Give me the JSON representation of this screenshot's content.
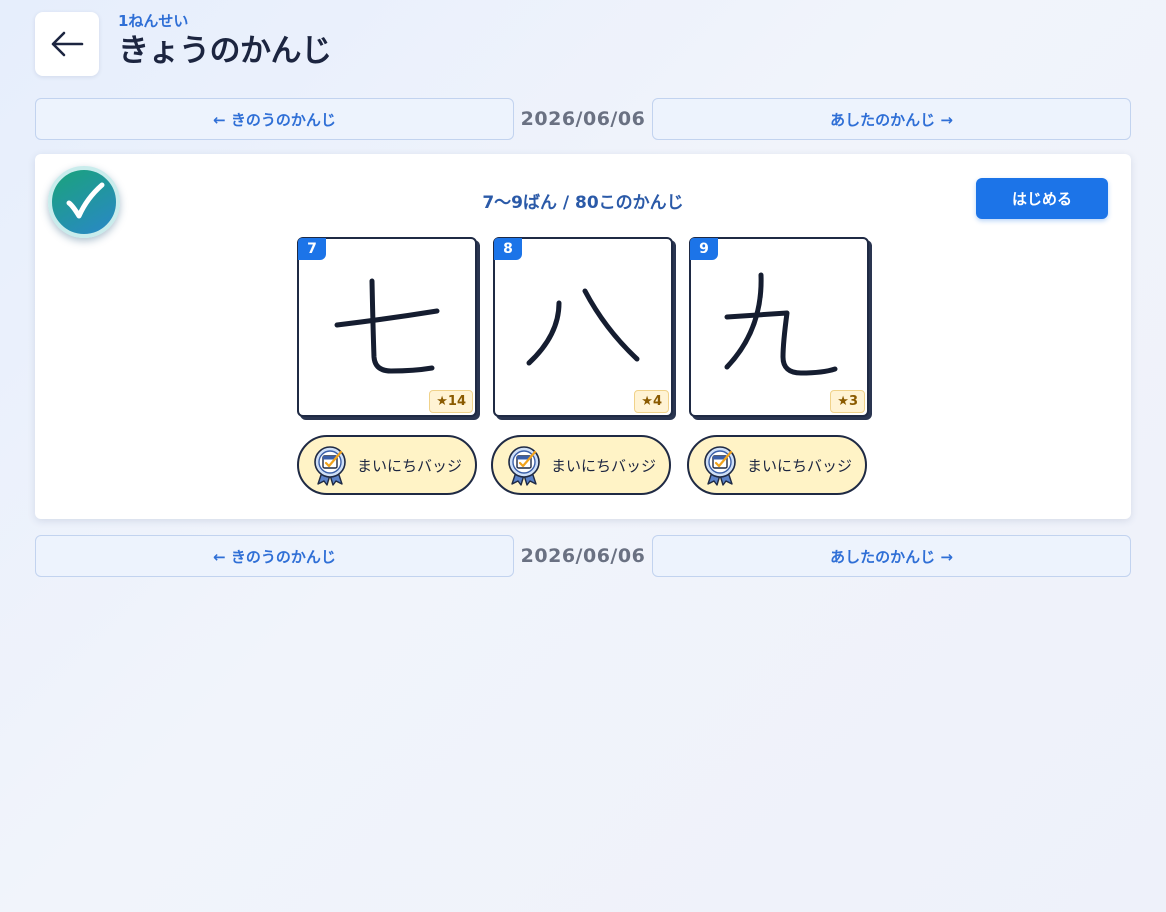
{
  "header": {
    "grade": "1ねんせい",
    "title": "きょうのかんじ"
  },
  "nav": {
    "prev_label": "← きのうのかんじ",
    "next_label": "あしたのかんじ →",
    "date": "2026/06/06"
  },
  "card": {
    "range_label": "7〜9ばん / 80このかんじ",
    "start_label": "はじめる",
    "kanji": [
      {
        "number": "7",
        "char": "七",
        "stars": "★14",
        "badge": "まいにちバッジ"
      },
      {
        "number": "8",
        "char": "八",
        "stars": "★4",
        "badge": "まいにちバッジ"
      },
      {
        "number": "9",
        "char": "九",
        "stars": "★3",
        "badge": "まいにちバッジ"
      }
    ]
  },
  "colors": {
    "accent": "#1c74e8",
    "text": "#1c2540",
    "badge_bg": "#fff3c6",
    "check_green": "#1aa37a"
  }
}
